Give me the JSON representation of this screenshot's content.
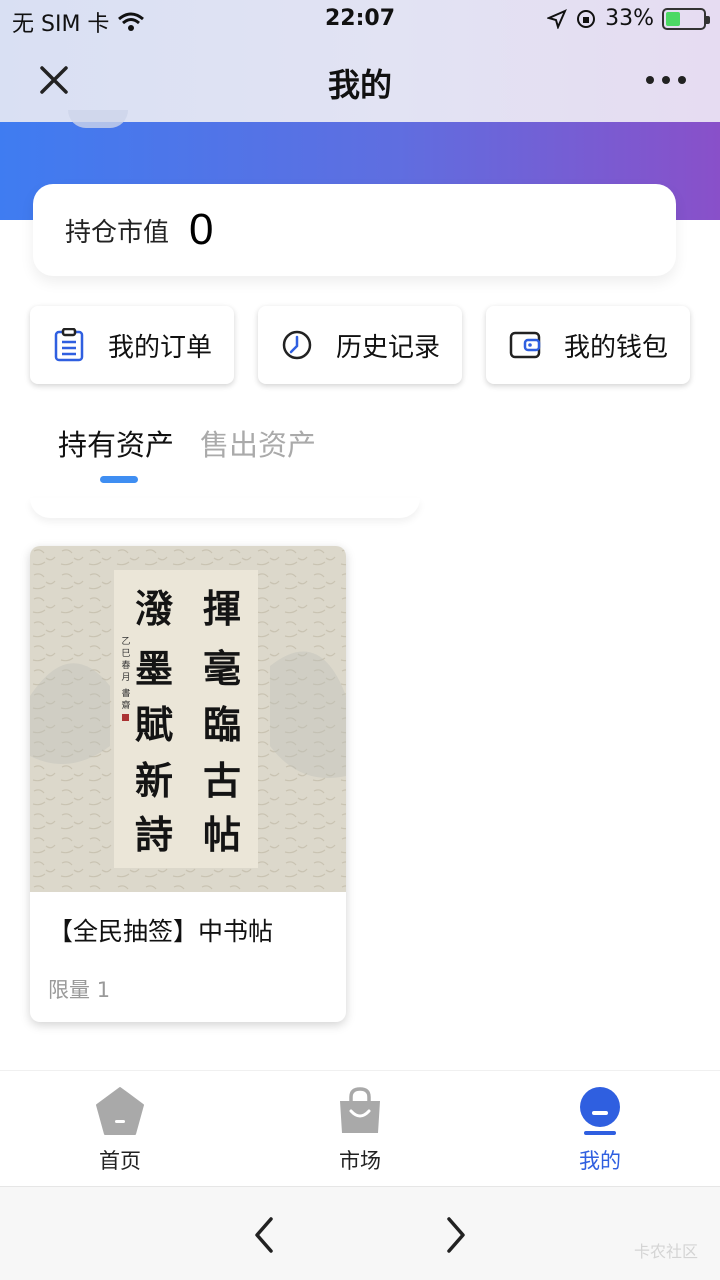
{
  "status_bar": {
    "carrier": "无 SIM 卡",
    "time": "22:07",
    "battery": "33%"
  },
  "nav": {
    "title": "我的"
  },
  "summary": {
    "label": "持仓市值",
    "value": "0"
  },
  "quick_actions": [
    {
      "label": "我的订单",
      "icon": "order-list-icon"
    },
    {
      "label": "历史记录",
      "icon": "clock-icon"
    },
    {
      "label": "我的钱包",
      "icon": "wallet-icon"
    }
  ],
  "tabs": {
    "active": "持有资产",
    "inactive": "售出资产"
  },
  "assets": [
    {
      "title": "【全民抽签】中书帖",
      "limit_label": "限量",
      "limit_value": "1",
      "image_text": {
        "right_column": "揮毫臨古帖",
        "left_column": "潑墨賦新詩",
        "inscription": "乙巳春月 書齋"
      }
    }
  ],
  "tabbar": [
    {
      "label": "首页",
      "icon": "home-icon",
      "active": false
    },
    {
      "label": "市场",
      "icon": "shopping-bag-icon",
      "active": false
    },
    {
      "label": "我的",
      "icon": "profile-icon",
      "active": true
    }
  ],
  "colors": {
    "accent": "#3f8ef2",
    "active_tab": "#2f5fe0",
    "banner_start": "#3f7cf1",
    "banner_end": "#8950c9"
  },
  "watermark": "卡农社区"
}
